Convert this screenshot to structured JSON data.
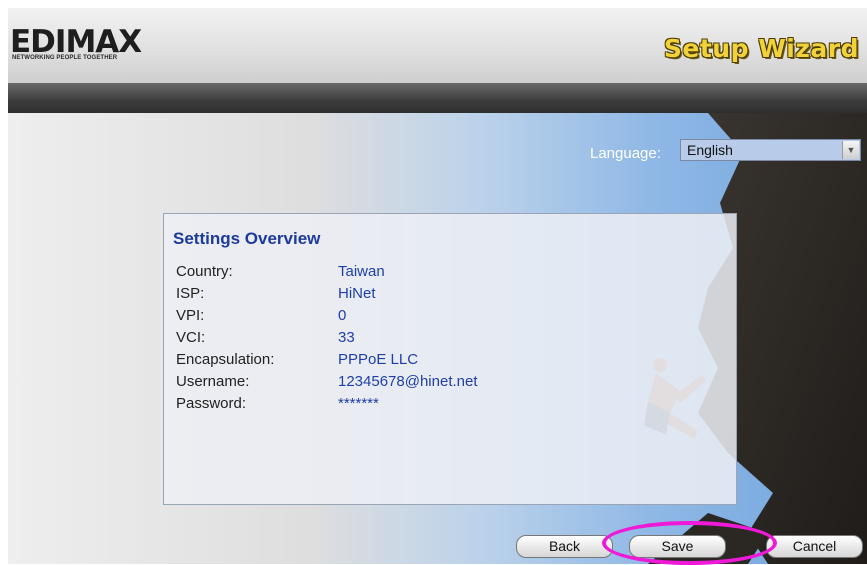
{
  "header": {
    "logo_text": "EDIMAX",
    "logo_tagline": "NETWORKING PEOPLE TOGETHER",
    "title": "Setup Wizard"
  },
  "language": {
    "label": "Language:",
    "selected": "English"
  },
  "overview": {
    "title": "Settings Overview",
    "rows": [
      {
        "label": "Country:",
        "value": "Taiwan"
      },
      {
        "label": "ISP:",
        "value": "HiNet"
      },
      {
        "label": "VPI:",
        "value": "0"
      },
      {
        "label": "VCI:",
        "value": "33"
      },
      {
        "label": "Encapsulation:",
        "value": "PPPoE LLC"
      },
      {
        "label": "Username:",
        "value": "12345678@hinet.net"
      },
      {
        "label": "Password:",
        "value": "*******"
      }
    ]
  },
  "buttons": {
    "back": "Back",
    "save": "Save",
    "cancel": "Cancel"
  },
  "colors": {
    "title_yellow": "#f2d23a",
    "panel_heading": "#1d3b9c",
    "value_blue": "#1f3fa8",
    "highlight": "#ee1ad8"
  }
}
